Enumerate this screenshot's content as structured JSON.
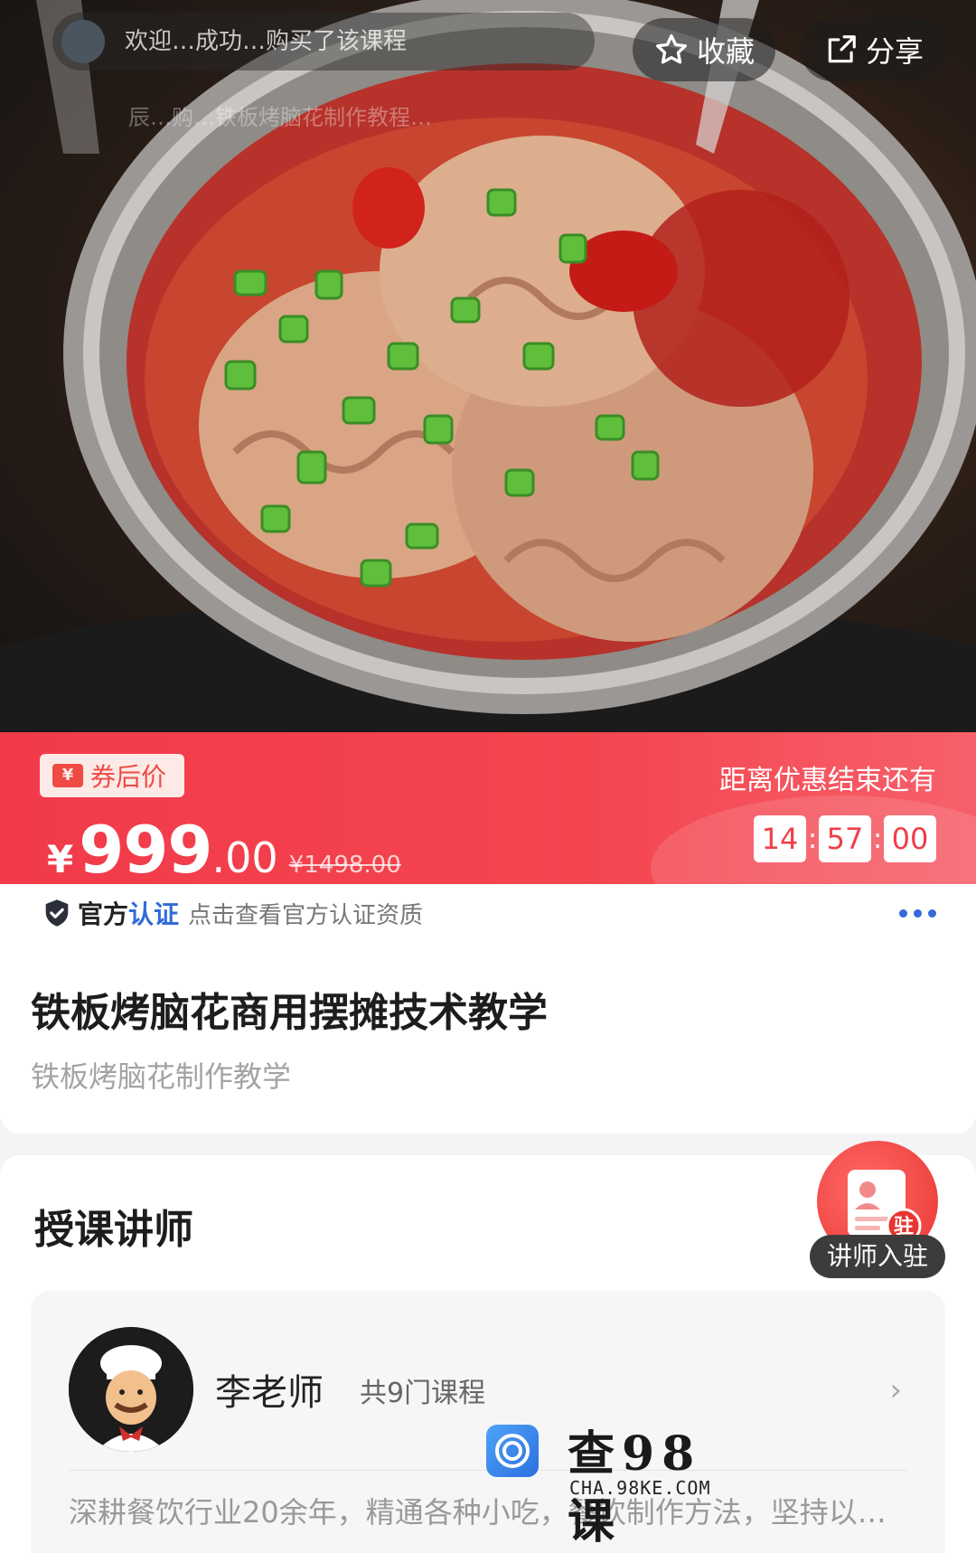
{
  "hero": {
    "ticker_text": "欢迎…成功…购买了该课程",
    "sub_ticker_text": "辰…购…铁板烤脑花制作教程…",
    "favorite_label": "收藏",
    "share_label": "分享"
  },
  "price": {
    "coupon_label": "券后价",
    "currency": "¥",
    "integer": "999",
    "decimal": ".00",
    "original": "¥1498.00",
    "countdown_label": "距离优惠结束还有",
    "countdown": {
      "hours": "14",
      "minutes": "57",
      "seconds": "00"
    }
  },
  "cert": {
    "official": "官方",
    "verified": "认证",
    "hint": "点击查看官方认证资质"
  },
  "course": {
    "title": "铁板烤脑花商用摆摊技术教学",
    "subtitle": "铁板烤脑花制作教学"
  },
  "teacher_section": {
    "heading": "授课讲师",
    "join_badge_char": "驻",
    "join_label": "讲师入驻",
    "teacher": {
      "name": "李老师",
      "course_count": "共9门课程",
      "bio": "深耕餐饮行业20余年，精通各种小吃，餐饮制作方法，坚持以…"
    }
  },
  "watermark": {
    "title": "查98课",
    "subtitle": "CHA.98KE.COM"
  },
  "colors": {
    "price_red": "#f23a4a",
    "cert_blue": "#2f6bd8",
    "badge_red": "#e9352f"
  }
}
